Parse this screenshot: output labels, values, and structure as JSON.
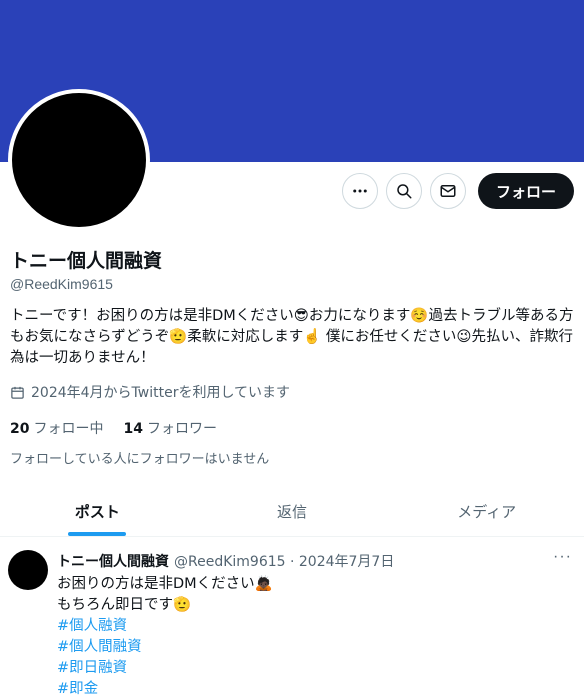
{
  "profile": {
    "display_name": "トニー個人間融資",
    "handle": "@ReedKim9615",
    "bio": "トニーです！お困りの方は是非DMください😎お力になります☺️過去トラブル等ある方もお気になさらずどうぞ🫡柔軟に対応します☝️ 僕にお任せください😉先払い、詐欺行為は一切ありません！",
    "joined": "2024年4月からTwitterを利用しています",
    "following_count": "20",
    "following_label": "フォロー中",
    "followers_count": "14",
    "followers_label": "フォロワー",
    "mutual_note": "フォローしている人にフォロワーはいません"
  },
  "actions": {
    "more_icon": "more-icon",
    "search_icon": "search-icon",
    "message_icon": "mail-icon",
    "follow_label": "フォロー"
  },
  "tabs": [
    {
      "label": "ポスト",
      "active": true
    },
    {
      "label": "返信",
      "active": false
    },
    {
      "label": "メディア",
      "active": false
    }
  ],
  "tweet": {
    "author": "トニー個人間融資",
    "meta": "@ReedKim9615 · 2024年7月7日",
    "more": "···",
    "lines": [
      "お困りの方は是非DMください🙇🏿",
      "もちろん即日です🫡"
    ],
    "hashtags": [
      "#個人融資",
      "#個人間融資",
      "#即日融資",
      "#即金"
    ]
  },
  "colors": {
    "banner": "#2a41b8",
    "accent": "#1d9bf0",
    "follow_button": "#0f1419"
  }
}
